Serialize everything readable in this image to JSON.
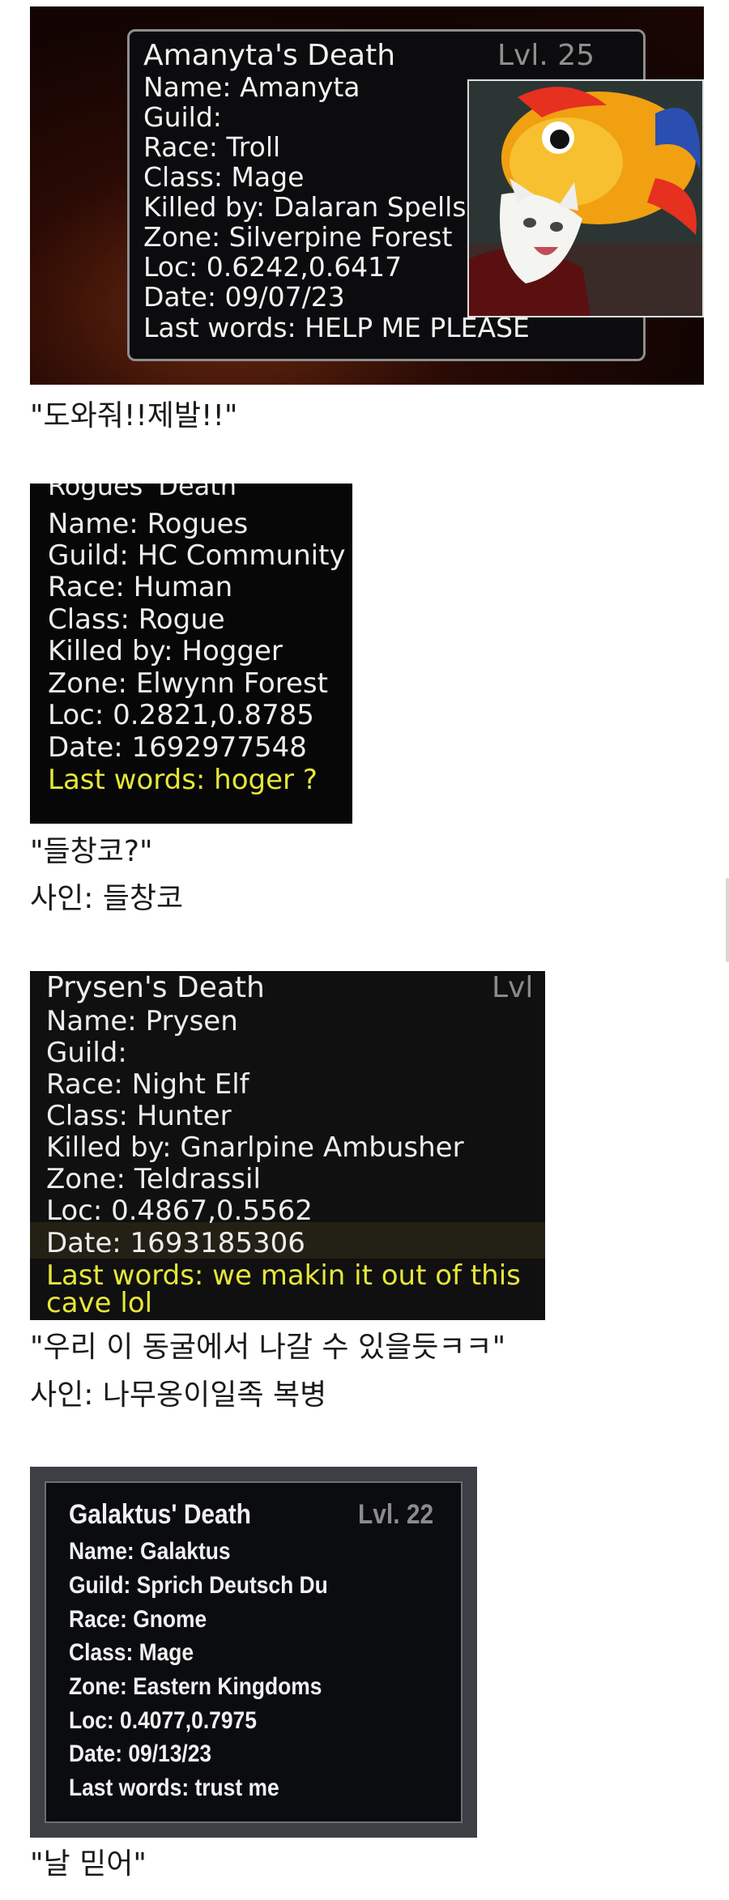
{
  "posts": [
    {
      "card": {
        "title": "Amanyta's Death",
        "level": "Lvl. 25",
        "lines": [
          "Name: Amanyta",
          "Guild:",
          "Race: Troll",
          "Class: Mage",
          "Killed by: Dalaran Spellsc",
          "Zone: Silverpine Forest",
          "Loc: 0.6242,0.6417",
          "Date: 09/07/23"
        ],
        "last_words": "Last words: HELP ME PLEASE"
      },
      "caption": "\"도와줘!!제발!!\""
    },
    {
      "card": {
        "title": "Rogues' Death",
        "lines": [
          "Name: Rogues",
          "Guild: HC Community",
          "Race: Human",
          "Class: Rogue",
          "Killed by: Hogger",
          "Zone: Elwynn Forest",
          "Loc: 0.2821,0.8785",
          "Date: 1692977548"
        ],
        "last_words": "Last words: hoger ?"
      },
      "caption": "\"들창코?\"",
      "sign": "사인: 들창코"
    },
    {
      "card": {
        "title": "Prysen's Death",
        "level": "Lvl",
        "lines": [
          "Name: Prysen",
          "Guild:",
          "Race: Night Elf",
          "Class: Hunter",
          "Killed by: Gnarlpine Ambusher",
          "Zone: Teldrassil",
          "Loc: 0.4867,0.5562",
          "Date: 1693185306"
        ],
        "last_words": [
          "Last words: we makin it out of this",
          "cave lol"
        ]
      },
      "caption": "\"우리 이 동굴에서 나갈 수 있을듯ㅋㅋ\"",
      "sign": "사인: 나무옹이일족 복병"
    },
    {
      "card": {
        "title": "Galaktus' Death",
        "level": "Lvl. 22",
        "lines": [
          "Name: Galaktus",
          "Guild: Sprich Deutsch Du",
          "Race: Gnome",
          "Class: Mage",
          "Zone: Eastern Kingdoms",
          "Loc: 0.4077,0.7975",
          "Date: 09/13/23"
        ],
        "last_words": "Last words: trust me"
      },
      "caption": "\"날 믿어\""
    }
  ]
}
